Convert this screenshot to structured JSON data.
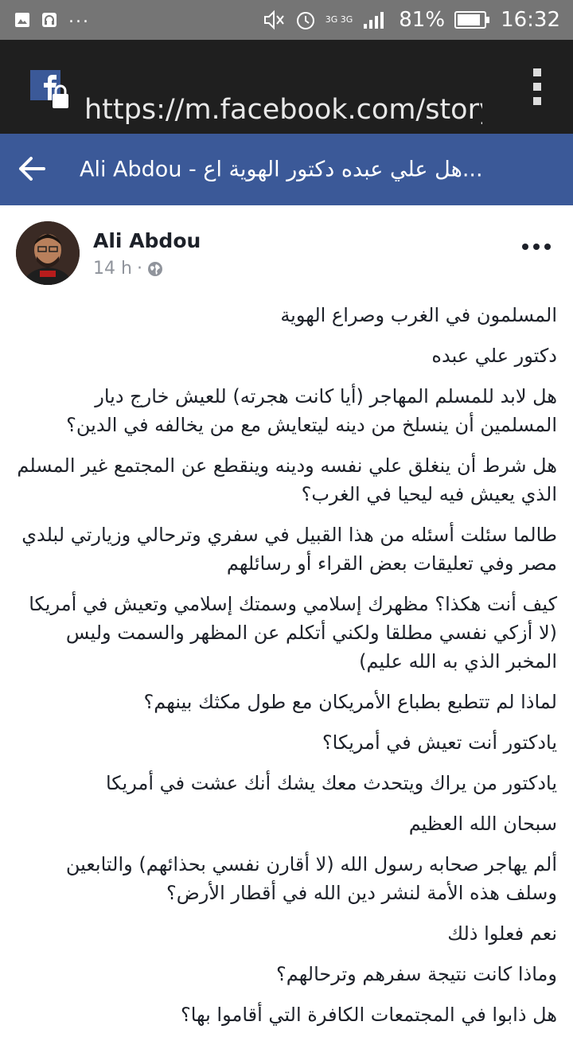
{
  "status_bar": {
    "battery": "81%",
    "time": "16:32",
    "network": "3G 3G",
    "icons": [
      "image-icon",
      "headset-icon",
      "more-notifications-icon",
      "mute-icon",
      "alarm-icon",
      "signal-icon",
      "battery-icon"
    ]
  },
  "browser": {
    "url": "https://m.facebook.com/story.p",
    "menu_icon": "overflow-menu-icon"
  },
  "fb_header": {
    "title": "Ali Abdou - هل علي عبده دكتور الهوية اع..."
  },
  "post": {
    "author": "Ali Abdou",
    "time": "14 h",
    "privacy_icon": "globe-icon",
    "paragraphs": [
      "المسلمون في الغرب وصراع الهوية",
      "دكتور علي عبده",
      "هل لابد للمسلم المهاجر (أيا كانت هجرته) للعيش خارج ديار المسلمين أن ينسلخ من دينه ليتعايش مع من يخالفه في الدين؟",
      "هل شرط أن ينغلق علي نفسه ودينه وينقطع عن المجتمع غير المسلم الذي يعيش فيه ليحيا في الغرب؟",
      "طالما سئلت أسئله من هذا القبيل في سفري وترحالي وزيارتي لبلدي مصر وفي تعليقات بعض القراء أو رسائلهم",
      "كيف أنت هكذا؟ مظهرك إسلامي وسمتك إسلامي وتعيش في أمريكا (لا أزكي نفسي مطلقا ولكني أتكلم عن المظهر والسمت وليس المخبر الذي به الله عليم)",
      "لماذا لم تتطبع بطباع الأمريكان مع طول مكثك بينهم؟",
      "يادكتور أنت تعيش في أمريكا؟",
      "يادكتور من يراك ويتحدث معك يشك أنك عشت في أمريكا",
      "سبحان الله العظيم",
      "ألم يهاجر صحابه رسول الله (لا أقارن نفسي بحذائهم) والتابعين وسلف هذه الأمة لنشر دين الله في أقطار الأرض؟",
      "نعم فعلوا ذلك",
      "وماذا كانت نتيجة سفرهم وترحالهم؟",
      "هل ذابوا في المجتمعات الكافرة التي أقاموا بها؟"
    ]
  },
  "colors": {
    "facebook_blue": "#3b5998",
    "status_bar": "#757575",
    "url_bar": "#1f1f1f",
    "text": "#1d2129",
    "meta": "#90949c"
  }
}
